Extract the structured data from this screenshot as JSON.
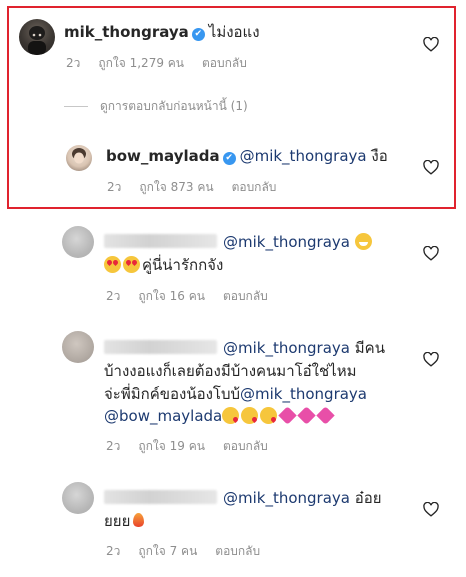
{
  "comments": [
    {
      "username": "mik_thongraya",
      "verified": true,
      "text": "ไม่งอแง",
      "time": "2ว",
      "likes": "ถูกใจ 1,279 คน",
      "reply": "ตอบกลับ"
    }
  ],
  "view_replies": "ดูการตอบกลับก่อนหน้านี้ (1)",
  "reply_comment": {
    "username": "bow_maylada",
    "verified": true,
    "mention": "@mik_thongraya",
    "text": "งือ",
    "time": "2ว",
    "likes": "ถูกใจ 873 คน",
    "reply": "ตอบกลับ"
  },
  "other_comments": [
    {
      "mention": "@mik_thongraya",
      "line2": "คู่นี่น่ารักกจัง",
      "time": "2ว",
      "likes": "ถูกใจ 16 คน",
      "reply": "ตอบกลับ"
    },
    {
      "mention": "@mik_thongraya",
      "text1": "มีคน",
      "line2": "บ้างงอแงก็เลยต้องมีบ้างคนมาโอ๋ใช่ไหม",
      "line3_text": "จ่ะพี่มิกค์ของน้องโบบ้",
      "line3_mention": "@mik_thongraya",
      "line4_mention": "@bow_maylada",
      "time": "2ว",
      "likes": "ถูกใจ 19 คน",
      "reply": "ตอบกลับ"
    },
    {
      "mention": "@mik_thongraya",
      "text1": "อ๋อย",
      "line2": "ยยย",
      "time": "2ว",
      "likes": "ถูกใจ 7 คน",
      "reply": "ตอบกลับ"
    }
  ],
  "icons": {
    "verified": "✔",
    "like": "heart-outline-icon"
  },
  "colors": {
    "highlight_border": "#e0232e",
    "verified_blue": "#3897f0",
    "mention": "#1d3a70",
    "meta": "#8e8e8e"
  }
}
